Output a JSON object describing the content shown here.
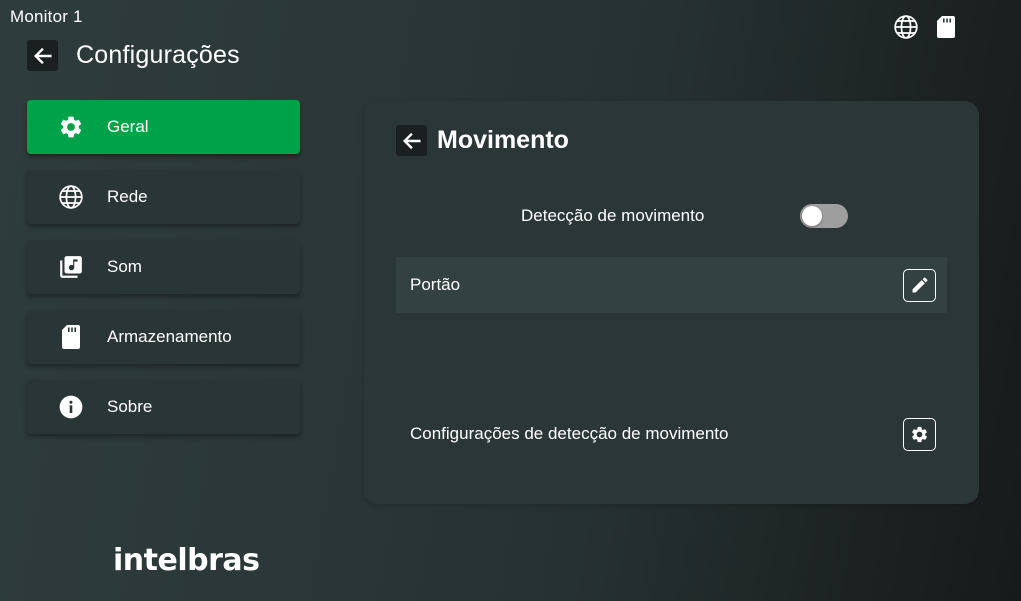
{
  "device": {
    "name": "Monitor 1"
  },
  "status_bar": {
    "icons": [
      {
        "name": "globe-icon"
      },
      {
        "name": "sd-card-icon"
      }
    ]
  },
  "header": {
    "title": "Configurações",
    "back_icon": "arrow-left-icon"
  },
  "sidebar": {
    "items": [
      {
        "id": "geral",
        "label": "Geral",
        "icon": "gear-icon",
        "active": true
      },
      {
        "id": "rede",
        "label": "Rede",
        "icon": "globe-icon",
        "active": false
      },
      {
        "id": "som",
        "label": "Som",
        "icon": "music-library-icon",
        "active": false
      },
      {
        "id": "armazenamento",
        "label": "Armazenamento",
        "icon": "sd-card-icon",
        "active": false
      },
      {
        "id": "sobre",
        "label": "Sobre",
        "icon": "info-icon",
        "active": false
      }
    ]
  },
  "panel": {
    "title": "Movimento",
    "motion_detection": {
      "label": "Detecção de movimento",
      "enabled": false
    },
    "zone": {
      "label": "Portão",
      "action_icon": "pencil-icon"
    },
    "detection_settings": {
      "label": "Configurações de detecção de movimento",
      "action_icon": "gear-icon"
    }
  },
  "branding": {
    "logo_text": "intelbras"
  },
  "colors": {
    "accent": "#00a249",
    "background": "#2c3838",
    "panel": "#2b3737",
    "toggle_off": "#9e9e9e"
  }
}
